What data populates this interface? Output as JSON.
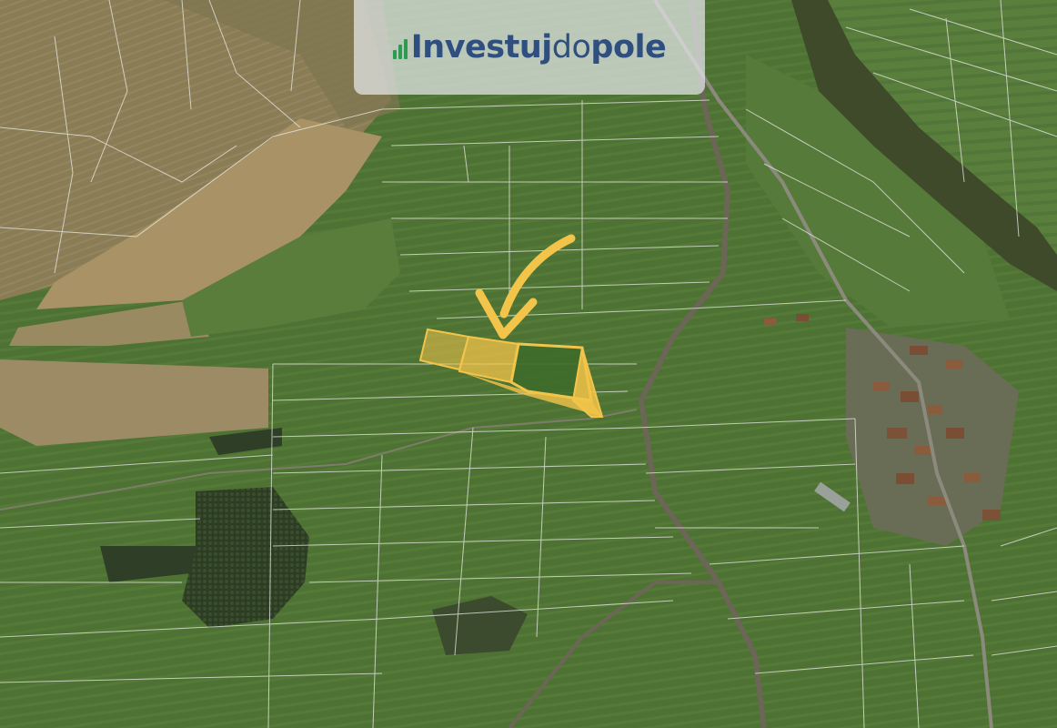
{
  "logo": {
    "brand_part1": "Investuj",
    "brand_part2": "do",
    "brand_part3": "pole",
    "brand_color": "#2e4f7f",
    "accent_color": "#2e9b52"
  },
  "map": {
    "type": "satellite cadastral map",
    "highlight_color": "#f3c44a",
    "arrow_color": "#f3c44a",
    "parcel_line_color": "#e8ece8",
    "field_color": "#4f7034",
    "dry_field_color": "#a38f62"
  }
}
